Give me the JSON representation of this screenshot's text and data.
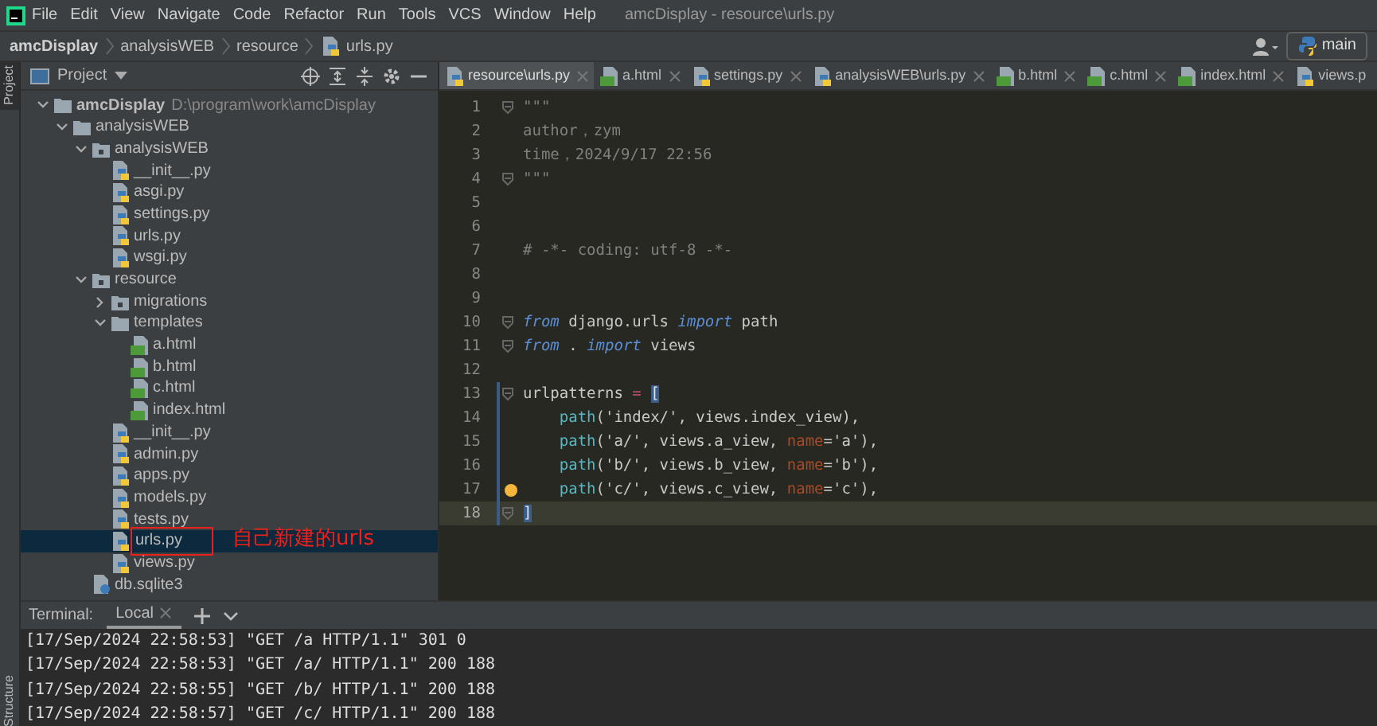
{
  "menu": [
    "File",
    "Edit",
    "View",
    "Navigate",
    "Code",
    "Refactor",
    "Run",
    "Tools",
    "VCS",
    "Window",
    "Help"
  ],
  "window": {
    "title": "amcDisplay - resource\\urls.py"
  },
  "breadcrumbs": [
    {
      "label": "amcDisplay",
      "kind": "project"
    },
    {
      "label": "analysisWEB",
      "kind": "folder"
    },
    {
      "label": "resource",
      "kind": "folder"
    },
    {
      "label": "urls.py",
      "kind": "python"
    }
  ],
  "run_config": {
    "label": "main"
  },
  "side_tabs": {
    "top": "Project",
    "bottom": "Structure"
  },
  "project_panel": {
    "title": "Project",
    "tree": [
      {
        "label": "amcDisplay",
        "path": "D:\\program\\work\\amcDisplay",
        "kind": "project",
        "expanded": true,
        "selected": false,
        "children": [
          {
            "label": "analysisWEB",
            "kind": "folder",
            "expanded": true,
            "selected": false,
            "children": [
              {
                "label": "analysisWEB",
                "kind": "package",
                "expanded": true,
                "selected": false,
                "children": [
                  {
                    "label": "__init__.py",
                    "kind": "python",
                    "selected": false
                  },
                  {
                    "label": "asgi.py",
                    "kind": "python",
                    "selected": false
                  },
                  {
                    "label": "settings.py",
                    "kind": "python",
                    "selected": false
                  },
                  {
                    "label": "urls.py",
                    "kind": "python",
                    "selected": false
                  },
                  {
                    "label": "wsgi.py",
                    "kind": "python",
                    "selected": false
                  }
                ]
              },
              {
                "label": "resource",
                "kind": "package",
                "expanded": true,
                "selected": false,
                "children": [
                  {
                    "label": "migrations",
                    "kind": "package",
                    "expanded": false,
                    "selected": false
                  },
                  {
                    "label": "templates",
                    "kind": "folder",
                    "expanded": true,
                    "selected": false,
                    "children": [
                      {
                        "label": "a.html",
                        "kind": "html",
                        "selected": false
                      },
                      {
                        "label": "b.html",
                        "kind": "html",
                        "selected": false
                      },
                      {
                        "label": "c.html",
                        "kind": "html",
                        "selected": false
                      },
                      {
                        "label": "index.html",
                        "kind": "html",
                        "selected": false
                      }
                    ]
                  },
                  {
                    "label": "__init__.py",
                    "kind": "python",
                    "selected": false
                  },
                  {
                    "label": "admin.py",
                    "kind": "python",
                    "selected": false
                  },
                  {
                    "label": "apps.py",
                    "kind": "python",
                    "selected": false
                  },
                  {
                    "label": "models.py",
                    "kind": "python",
                    "selected": false
                  },
                  {
                    "label": "tests.py",
                    "kind": "python",
                    "selected": false
                  },
                  {
                    "label": "urls.py",
                    "kind": "python",
                    "selected": true,
                    "annotation": "自己新建的urls"
                  },
                  {
                    "label": "views.py",
                    "kind": "python",
                    "selected": false
                  }
                ]
              },
              {
                "label": "db.sqlite3",
                "kind": "sqlite",
                "selected": false
              }
            ]
          }
        ]
      }
    ]
  },
  "tabs": [
    {
      "label": "resource\\urls.py",
      "kind": "python",
      "selected": true
    },
    {
      "label": "a.html",
      "kind": "html",
      "selected": false
    },
    {
      "label": "settings.py",
      "kind": "python",
      "selected": false
    },
    {
      "label": "analysisWEB\\urls.py",
      "kind": "python",
      "selected": false
    },
    {
      "label": "b.html",
      "kind": "html",
      "selected": false
    },
    {
      "label": "c.html",
      "kind": "html",
      "selected": false
    },
    {
      "label": "index.html",
      "kind": "html",
      "selected": false
    },
    {
      "label": "views.p",
      "kind": "python",
      "selected": false,
      "cut": true
    }
  ],
  "editor": {
    "lines": [
      {
        "number": "1",
        "fold": true,
        "tokens": [
          {
            "text": "\"\"\"",
            "kind": "comment"
          }
        ]
      },
      {
        "number": "2",
        "tokens": [
          {
            "text": "author，zym",
            "kind": "comment"
          }
        ]
      },
      {
        "number": "3",
        "tokens": [
          {
            "text": "time，2024/9/17 22:56",
            "kind": "comment"
          }
        ]
      },
      {
        "number": "4",
        "fold": true,
        "tokens": [
          {
            "text": "\"\"\"",
            "kind": "comment"
          }
        ]
      },
      {
        "number": "5"
      },
      {
        "number": "6"
      },
      {
        "number": "7",
        "tokens": [
          {
            "text": "# -*- coding: utf-8 -*-",
            "kind": "comment"
          }
        ]
      },
      {
        "number": "8"
      },
      {
        "number": "9"
      },
      {
        "number": "10",
        "fold": true,
        "tokens": [
          {
            "text": "from",
            "kind": "keyword"
          },
          {
            "text": " django.urls ",
            "kind": "plain"
          },
          {
            "text": "import",
            "kind": "keyword"
          },
          {
            "text": " path",
            "kind": "plain"
          }
        ]
      },
      {
        "number": "11",
        "fold": true,
        "tokens": [
          {
            "text": "from",
            "kind": "keyword"
          },
          {
            "text": " . ",
            "kind": "plain"
          },
          {
            "text": "import",
            "kind": "keyword"
          },
          {
            "text": " views",
            "kind": "plain"
          }
        ]
      },
      {
        "number": "12"
      },
      {
        "number": "13",
        "fold": true,
        "changed": true,
        "tokens": [
          {
            "text": "urlpatterns ",
            "kind": "plain"
          },
          {
            "text": "= ",
            "kind": "op"
          },
          {
            "text": "[",
            "kind": "bracket"
          }
        ]
      },
      {
        "number": "14",
        "changed": true,
        "tokens": [
          {
            "text": "    path",
            "kind": "call"
          },
          {
            "text": "('index/', views.index_view),",
            "kind": "plain"
          }
        ]
      },
      {
        "number": "15",
        "changed": true,
        "tokens": [
          {
            "text": "    path",
            "kind": "call"
          },
          {
            "text": "('a/', views.a_view, ",
            "kind": "plain"
          },
          {
            "text": "name",
            "kind": "param"
          },
          {
            "text": "='a'),",
            "kind": "plain"
          }
        ]
      },
      {
        "number": "16",
        "changed": true,
        "tokens": [
          {
            "text": "    path",
            "kind": "call"
          },
          {
            "text": "('b/', views.b_view, ",
            "kind": "plain"
          },
          {
            "text": "name",
            "kind": "param"
          },
          {
            "text": "='b'),",
            "kind": "plain"
          }
        ]
      },
      {
        "number": "17",
        "changed": true,
        "bulb": true,
        "tokens": [
          {
            "text": "    path",
            "kind": "call"
          },
          {
            "text": "('c/', views.c_view, ",
            "kind": "plain"
          },
          {
            "text": "name",
            "kind": "param"
          },
          {
            "text": "='c'),",
            "kind": "plain"
          }
        ]
      },
      {
        "number": "18",
        "fold": true,
        "changed": true,
        "current": true,
        "tokens": [
          {
            "text": "]",
            "kind": "bracket"
          }
        ]
      }
    ]
  },
  "terminal": {
    "title": "Terminal:",
    "tabs": [
      {
        "label": "Local",
        "selected": true
      }
    ],
    "lines": [
      "[17/Sep/2024 22:58:53] \"GET /a HTTP/1.1\" 301 0",
      "[17/Sep/2024 22:58:53] \"GET /a/ HTTP/1.1\" 200 188",
      "[17/Sep/2024 22:58:55] \"GET /b/ HTTP/1.1\" 200 188",
      "[17/Sep/2024 22:58:57] \"GET /c/ HTTP/1.1\" 200 188"
    ]
  }
}
